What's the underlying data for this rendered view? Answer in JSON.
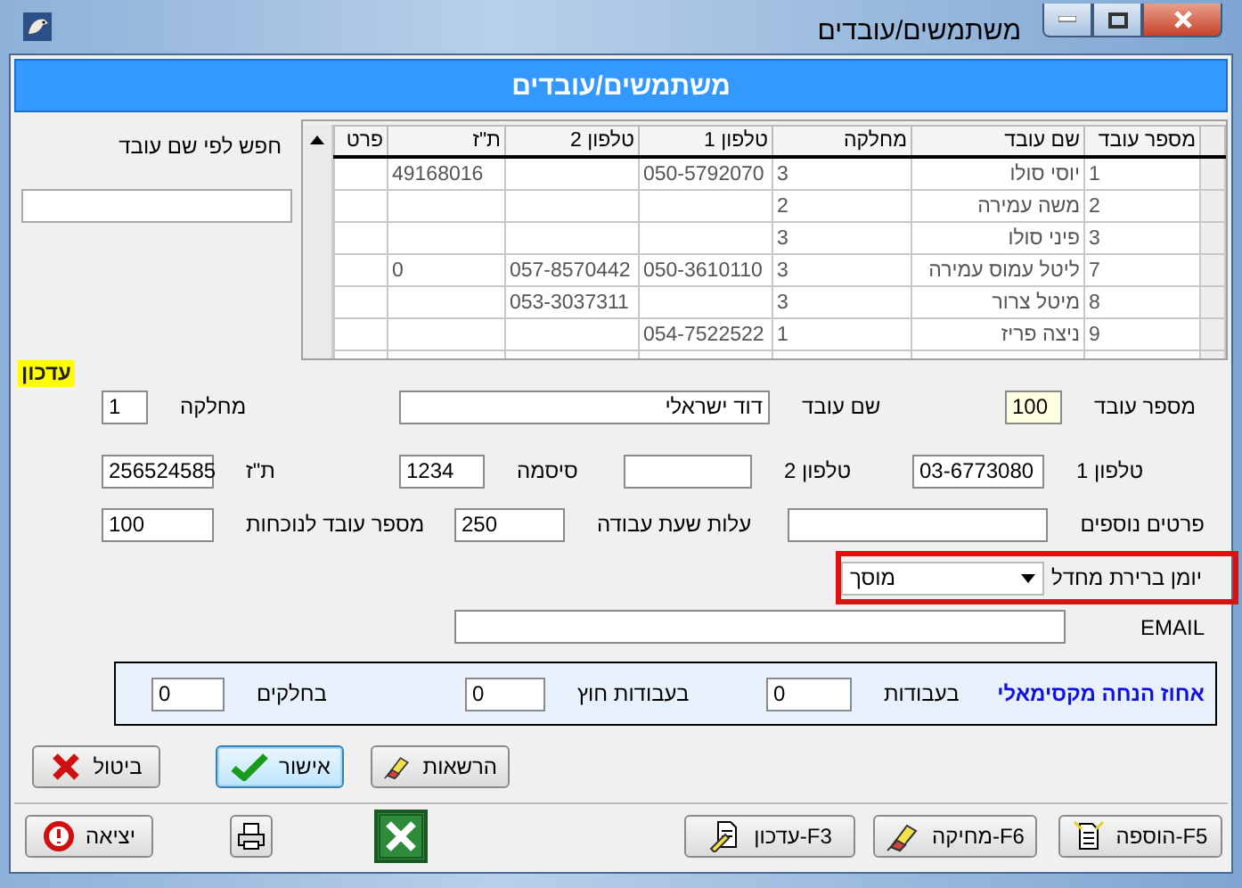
{
  "window": {
    "title": "משתמשים/עובדים"
  },
  "header": {
    "title": "משתמשים/עובדים"
  },
  "table": {
    "columns": [
      "מספר עובד",
      "שם עובד",
      "מחלקה",
      "טלפון 1",
      "טלפון 2",
      "ת\"ז",
      "פרט"
    ],
    "rows": [
      [
        "1",
        "יוסי סולו",
        "3",
        "050-5792070",
        null,
        "49168016",
        null
      ],
      [
        "2",
        "משה עמירה",
        "2",
        null,
        null,
        null,
        null
      ],
      [
        "3",
        "פיני סולו",
        "3",
        null,
        null,
        null,
        null
      ],
      [
        "7",
        "ליטל עמוס עמירה",
        "3",
        "050-3610110",
        "057-8570442",
        "0",
        null
      ],
      [
        "8",
        "מיטל צרור",
        "3",
        null,
        "053-3037311",
        null,
        null
      ],
      [
        "9",
        "ניצה פריז",
        "1",
        "054-7522522",
        null,
        null,
        null
      ]
    ]
  },
  "search": {
    "label": "חפש לפי שם עובד"
  },
  "mode_badge": "עדכון",
  "form": {
    "rows": [
      [
        {
          "label": "מספר עובד",
          "value": "100",
          "focused": true
        },
        {
          "label": "שם עובד",
          "value": "דוד ישראלי",
          "focused": false
        },
        {
          "label": "מחלקה",
          "value": "1",
          "focused": false
        }
      ],
      [
        {
          "label": "טלפון 1",
          "value": "03-6773080",
          "focused": false
        },
        {
          "label": "טלפון 2",
          "focused": false
        },
        {
          "label": "סיסמה",
          "value": "1234",
          "focused": false
        },
        {
          "label": "ת\"ז",
          "value": "256524585",
          "focused": false
        }
      ],
      [
        {
          "label": "פרטים נוספים",
          "focused": false
        },
        {
          "label": "עלות שעת עבודה",
          "value": "250",
          "focused": false
        },
        {
          "label": "מספר עובד לנוכחות",
          "value": "100",
          "focused": false
        }
      ]
    ],
    "calendar": {
      "label": "יומן ברירת מחדל",
      "value": "מוסך",
      "highlighted": true
    },
    "email": {
      "label": "EMAIL"
    }
  },
  "discount": {
    "title": "אחוז הנחה מקסימאלי",
    "fields": [
      {
        "label": "בעבודות",
        "value": "0"
      },
      {
        "label": "בעבודות חוץ",
        "value": "0"
      },
      {
        "label": "בחלקים",
        "value": "0"
      }
    ]
  },
  "actions": [
    {
      "label": "הרשאות",
      "focused": false
    },
    {
      "label": "אישור",
      "focused": true
    },
    {
      "label": "ביטול",
      "focused": false
    }
  ],
  "toolbar": [
    {
      "label": "F5-הוספה"
    },
    {
      "label": "F6-מחיקה"
    },
    {
      "label": "F3-עדכון"
    },
    {
      "label": "יציאה"
    }
  ]
}
